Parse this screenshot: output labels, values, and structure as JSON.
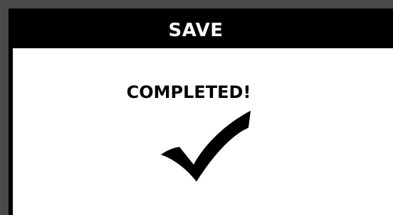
{
  "dialog": {
    "title": "SAVE",
    "message": "COMPLETED!",
    "icon": "checkmark-icon"
  },
  "colors": {
    "background": "#4a4a4a",
    "title_bar": "#000000",
    "title_text": "#ffffff",
    "panel": "#ffffff",
    "text": "#000000"
  }
}
